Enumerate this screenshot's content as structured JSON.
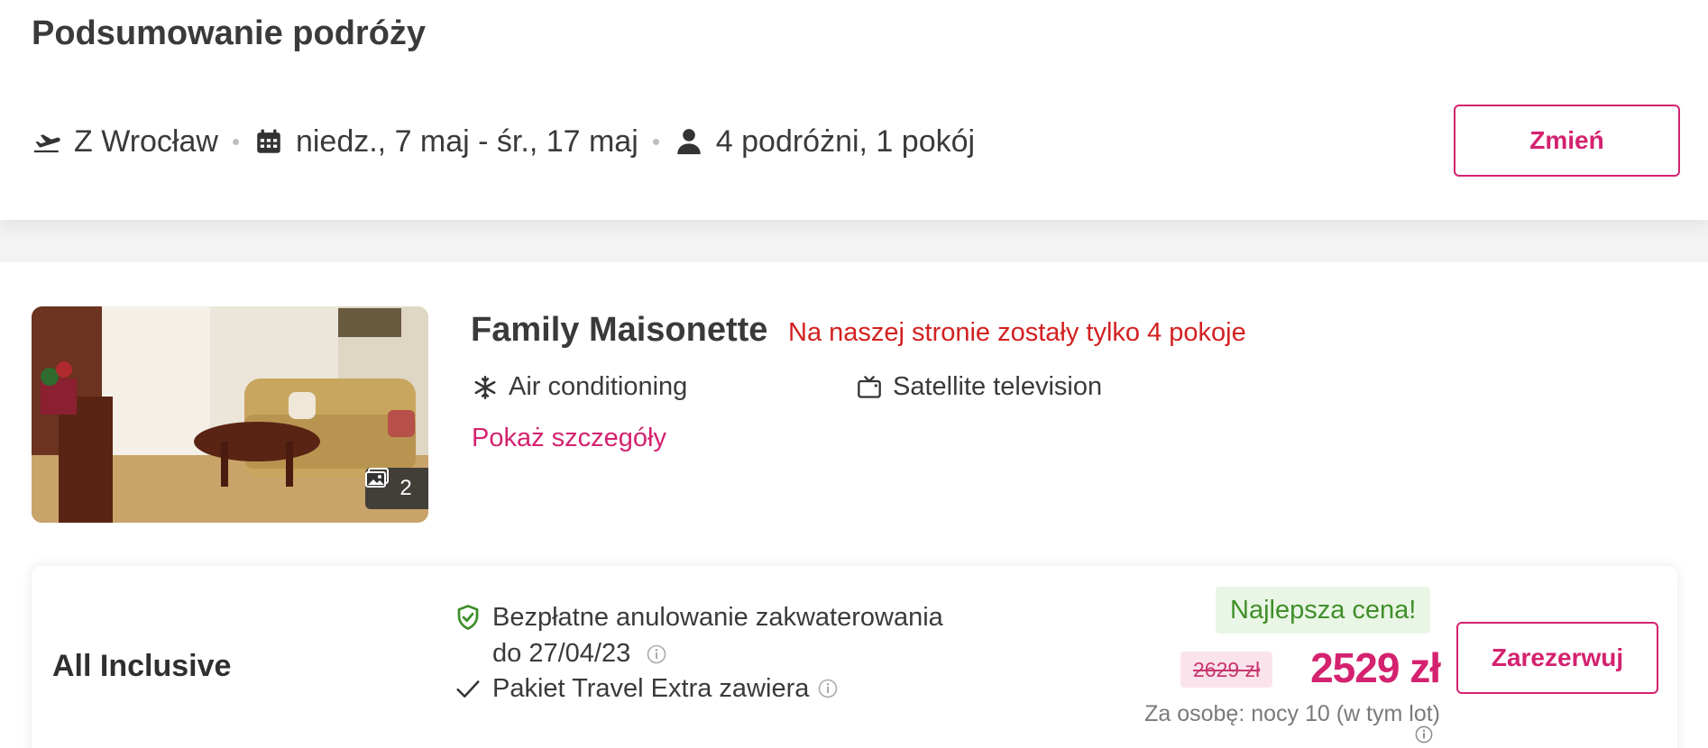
{
  "summary": {
    "title": "Podsumowanie podróży",
    "departure": "Z Wrocław",
    "dates": "niedz., 7 maj - śr., 17 maj",
    "travelers": "4 podróżni, 1 pokój",
    "change_label": "Zmień"
  },
  "room": {
    "name": "Family Maisonette",
    "availability": "Na naszej stronie zostały tylko 4 pokoje",
    "photo_count": "2",
    "amenities": [
      {
        "icon": "snowflake-icon",
        "label": "Air conditioning"
      },
      {
        "icon": "tv-icon",
        "label": "Satellite television"
      }
    ],
    "details_link": "Pokaż szczegóły"
  },
  "offer": {
    "board_type": "All Inclusive",
    "cancellation_line1": "Bezpłatne anulowanie zakwaterowania",
    "cancellation_line2": "do 27/04/23",
    "package_text": "Pakiet Travel Extra zawiera",
    "best_price_badge": "Najlepsza cena!",
    "old_price": "2629 zł",
    "price": "2529 zł",
    "price_note": "Za osobę: nocy 10 (w tym lot)",
    "book_label": "Zarezerwuj"
  },
  "colors": {
    "accent": "#d4226f",
    "alert": "#d32020",
    "success": "#3f8f2a",
    "success_bg": "#eaf6e5",
    "old_price_bg": "#fbe3ec"
  }
}
